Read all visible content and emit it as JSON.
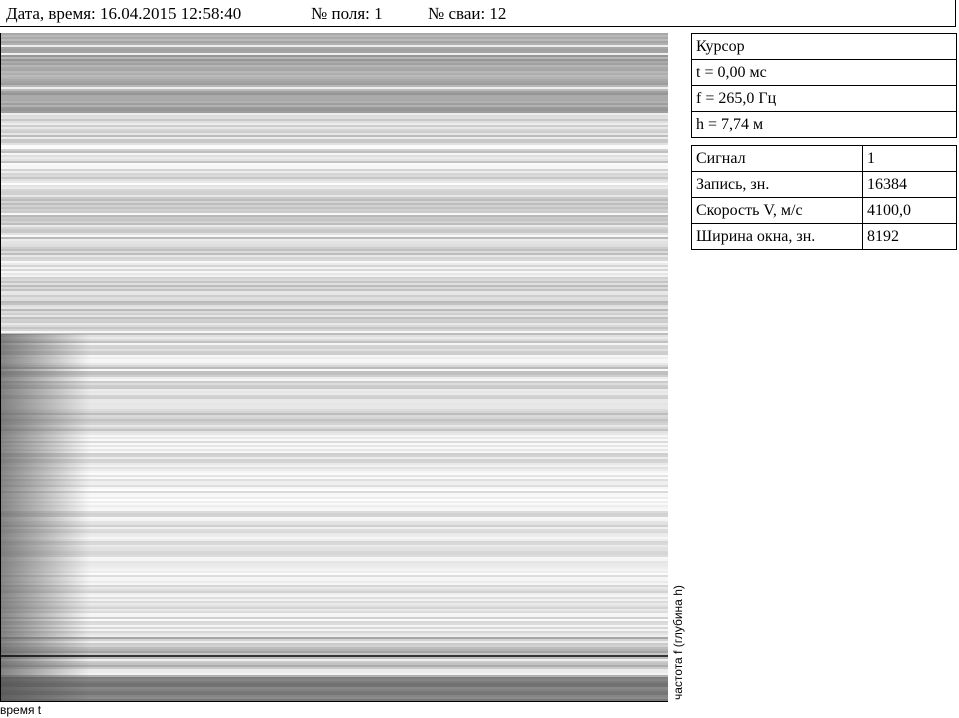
{
  "header": {
    "datetime_label": "Дата, время: 16.04.2015  12:58:40",
    "field_label": "№ поля:  1",
    "pile_label": "№ сваи:  12"
  },
  "cursor_panel": {
    "title": "Курсор",
    "t": "t = 0,00 мс",
    "f": "f = 265,0 Гц",
    "h": "h = 7,74 м"
  },
  "params": [
    {
      "label": "Сигнал",
      "value": "1"
    },
    {
      "label": "Запись, зн.",
      "value": "16384"
    },
    {
      "label": "Скорость V, м/с",
      "value": "4100,0"
    },
    {
      "label": "Ширина окна, зн.",
      "value": "8192"
    }
  ],
  "plot": {
    "x_axis_label": "время t",
    "y_axis_label": "частота f  (глубина h)",
    "colormap": "grayscale",
    "cursor_line_color": "#000000"
  }
}
